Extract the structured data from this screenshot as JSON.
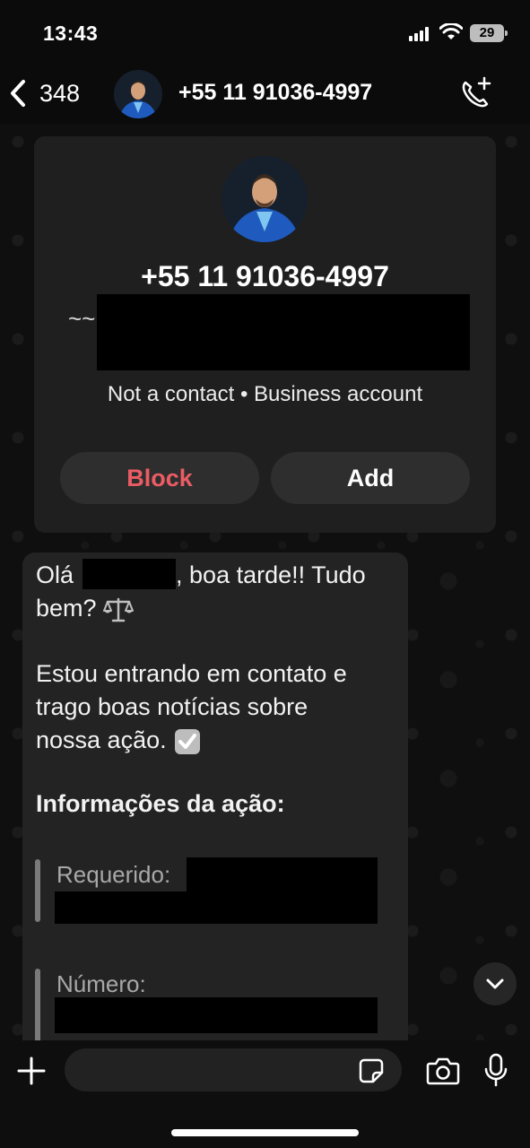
{
  "status_bar": {
    "time": "13:43",
    "battery": "29"
  },
  "header": {
    "back_count": "348",
    "title": "+55 11 91036-4997",
    "back_icon": "chevron-left-icon",
    "call_icon": "phone-add-icon"
  },
  "contact_card": {
    "phone": "+55 11 91036-4997",
    "about_prefix": "~~",
    "meta": "Not a contact • Business account",
    "block_label": "Block",
    "add_label": "Add",
    "block_color": "#ec5c64"
  },
  "message": {
    "greeting_start": "Olá",
    "greeting_end": ", boa tarde!! Tudo",
    "greeting_line2": "bem?",
    "para2_line1": "Estou entrando em contato e",
    "para2_line2": "trago boas notícias sobre",
    "para2_line3": "nossa ação.",
    "section_title": "Informações da ação:",
    "quote1_label": "Requerido:",
    "quote2_label": "Número:"
  },
  "input_bar": {
    "placeholder": ""
  },
  "colors": {
    "background": "#0b0b0b",
    "bubble": "#232323",
    "card": "#1f1f1f",
    "button": "#2e2e2e"
  }
}
